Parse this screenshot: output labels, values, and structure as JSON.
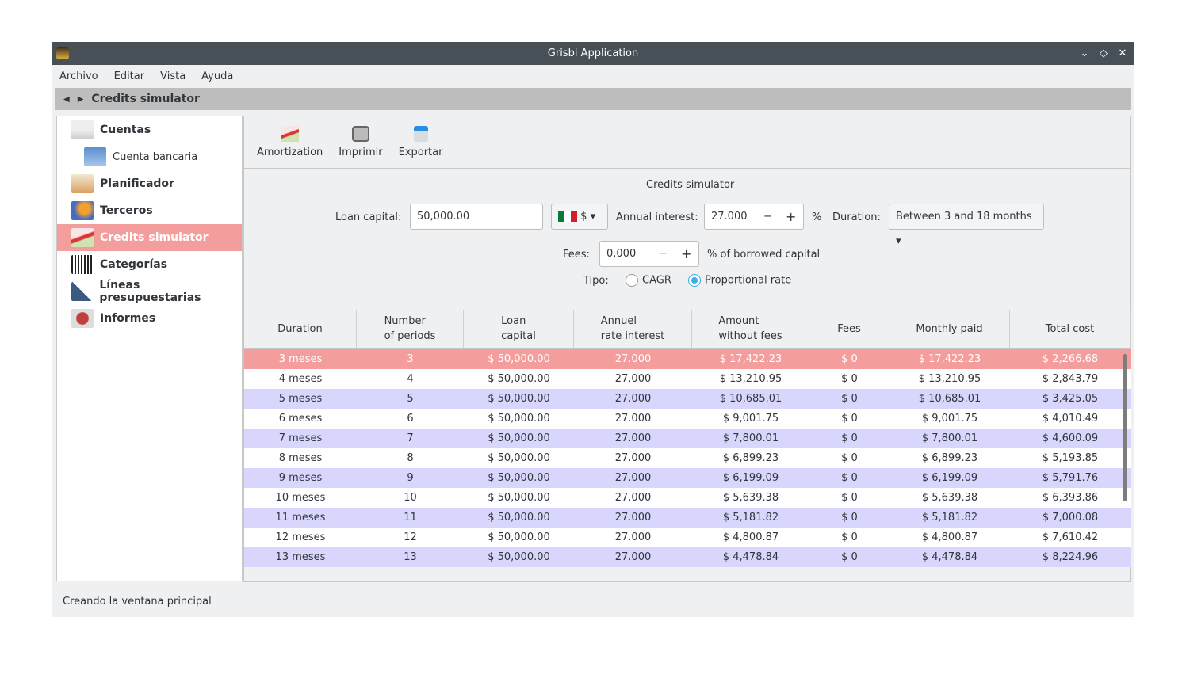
{
  "window": {
    "title": "Grisbi Application"
  },
  "menu": [
    "Archivo",
    "Editar",
    "Vista",
    "Ayuda"
  ],
  "breadcrumb": "Credits simulator",
  "sidebar": [
    {
      "label": "Cuentas",
      "icon": "accounts-icon",
      "sub": false
    },
    {
      "label": "Cuenta bancaria",
      "icon": "bank-card-icon",
      "sub": true
    },
    {
      "label": "Planificador",
      "icon": "calendar-icon",
      "sub": false
    },
    {
      "label": "Terceros",
      "icon": "people-icon",
      "sub": false
    },
    {
      "label": "Credits simulator",
      "icon": "chart-down-icon",
      "sub": false,
      "selected": true
    },
    {
      "label": "Categorías",
      "icon": "barcode-icon",
      "sub": false
    },
    {
      "label": "Líneas presupuestarias",
      "icon": "budget-chart-icon",
      "sub": false
    },
    {
      "label": "Informes",
      "icon": "report-pie-icon",
      "sub": false
    }
  ],
  "toolbar": {
    "amortization": "Amortization",
    "print": "Imprimir",
    "export": "Exportar"
  },
  "form": {
    "title": "Credits simulator",
    "loan_label": "Loan capital:",
    "loan_value": "50,000.00",
    "currency": "$",
    "interest_label": "Annual interest:",
    "interest_value": "27.000",
    "percent": "%",
    "duration_label": "Duration:",
    "duration_value": "Between 3 and 18 months",
    "fees_label": "Fees:",
    "fees_value": "0.000",
    "fees_suffix": "% of borrowed capital",
    "tipo_label": "Tipo:",
    "cagr": "CAGR",
    "proportional": "Proportional rate",
    "selected_type": "Proportional rate"
  },
  "table": {
    "columns": [
      "Duration",
      "Number\nof periods",
      "Loan\ncapital",
      "Annuel\nrate interest",
      "Amount\nwithout fees",
      "Fees",
      "Monthly paid",
      "Total cost"
    ],
    "rows": [
      [
        "3 meses",
        "3",
        "$ 50,000.00",
        "27.000",
        "$ 17,422.23",
        "$ 0",
        "$ 17,422.23",
        "$ 2,266.68"
      ],
      [
        "4 meses",
        "4",
        "$ 50,000.00",
        "27.000",
        "$ 13,210.95",
        "$ 0",
        "$ 13,210.95",
        "$ 2,843.79"
      ],
      [
        "5 meses",
        "5",
        "$ 50,000.00",
        "27.000",
        "$ 10,685.01",
        "$ 0",
        "$ 10,685.01",
        "$ 3,425.05"
      ],
      [
        "6 meses",
        "6",
        "$ 50,000.00",
        "27.000",
        "$ 9,001.75",
        "$ 0",
        "$ 9,001.75",
        "$ 4,010.49"
      ],
      [
        "7 meses",
        "7",
        "$ 50,000.00",
        "27.000",
        "$ 7,800.01",
        "$ 0",
        "$ 7,800.01",
        "$ 4,600.09"
      ],
      [
        "8 meses",
        "8",
        "$ 50,000.00",
        "27.000",
        "$ 6,899.23",
        "$ 0",
        "$ 6,899.23",
        "$ 5,193.85"
      ],
      [
        "9 meses",
        "9",
        "$ 50,000.00",
        "27.000",
        "$ 6,199.09",
        "$ 0",
        "$ 6,199.09",
        "$ 5,791.76"
      ],
      [
        "10 meses",
        "10",
        "$ 50,000.00",
        "27.000",
        "$ 5,639.38",
        "$ 0",
        "$ 5,639.38",
        "$ 6,393.86"
      ],
      [
        "11 meses",
        "11",
        "$ 50,000.00",
        "27.000",
        "$ 5,181.82",
        "$ 0",
        "$ 5,181.82",
        "$ 7,000.08"
      ],
      [
        "12 meses",
        "12",
        "$ 50,000.00",
        "27.000",
        "$ 4,800.87",
        "$ 0",
        "$ 4,800.87",
        "$ 7,610.42"
      ],
      [
        "13 meses",
        "13",
        "$ 50,000.00",
        "27.000",
        "$ 4,478.84",
        "$ 0",
        "$ 4,478.84",
        "$ 8,224.96"
      ]
    ],
    "selected_row": 0
  },
  "status": "Creando la ventana principal",
  "colors": {
    "selection": "#f49d9d",
    "alt_row": "#d8d6fd",
    "titlebar": "#475057",
    "accent": "#3daee9"
  }
}
